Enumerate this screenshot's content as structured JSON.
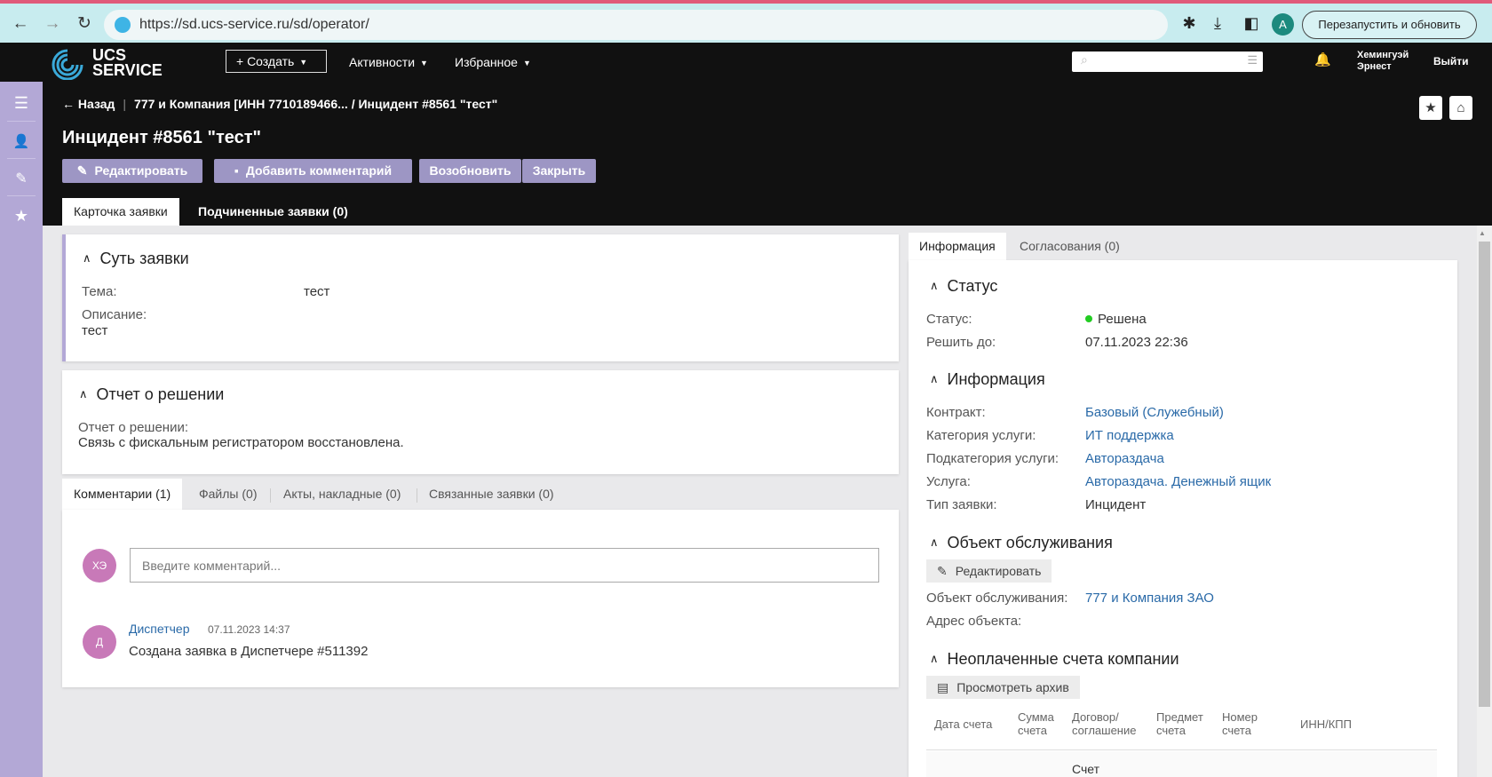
{
  "browser": {
    "url": "https://sd.ucs-service.ru/sd/operator/",
    "profile_initial": "A",
    "restart_label": "Перезапустить и обновить"
  },
  "topbar": {
    "logo_line1": "UCS",
    "logo_line2": "SERVICE",
    "create_label": "+ Создать",
    "activities_label": "Активности",
    "favorites_label": "Избранное",
    "user_first": "Хемингуэй",
    "user_last": "Эрнест",
    "logout_label": "Выйти"
  },
  "header": {
    "back_label": "← Назад",
    "crumb_company": "777 и Компания [ИНН 7710189466...",
    "crumb_incident": "/ Инцидент #8561 \"тест\"",
    "title": "Инцидент #8561 \"тест\"",
    "actions": {
      "edit": "Редактировать",
      "add_comment": "Добавить комментарий",
      "resume": "Возобновить",
      "close": "Закрыть"
    },
    "tabs": {
      "card": "Карточка заявки",
      "children": "Подчиненные заявки (0)"
    }
  },
  "essence": {
    "title": "Суть заявки",
    "subject_label": "Тема:",
    "subject_value": "тест",
    "description_label": "Описание:",
    "description_value": "тест"
  },
  "report": {
    "title": "Отчет о решении",
    "label": "Отчет о решении:",
    "value": "Связь с фискальным регистратором восстановлена."
  },
  "comment_tabs": {
    "comments": "Комментарии (1)",
    "files": "Файлы (0)",
    "acts": "Акты, накладные (0)",
    "linked": "Связанные заявки (0)"
  },
  "comments": {
    "my_initials": "ХЭ",
    "placeholder": "Введите комментарий...",
    "items": [
      {
        "initials": "Д",
        "author": "Диспетчер",
        "time": "07.11.2023 14:37",
        "text": "Создана заявка в Диспетчере #511392"
      }
    ]
  },
  "right_tabs": {
    "info": "Информация",
    "approvals": "Согласования (0)"
  },
  "status": {
    "title": "Статус",
    "status_label": "Статус:",
    "status_value": "Решена",
    "status_color": "#22cc22",
    "due_label": "Решить до:",
    "due_value": "07.11.2023 22:36"
  },
  "info": {
    "title": "Информация",
    "contract_label": "Контракт:",
    "contract_value": "Базовый (Служебный)",
    "category_label": "Категория услуги:",
    "category_value": "ИТ поддержка",
    "subcategory_label": "Подкатегория услуги:",
    "subcategory_value": "Авторaздача",
    "service_label": "Услуга:",
    "service_value": "Авторaздача. Денежный ящик",
    "type_label": "Тип заявки:",
    "type_value": "Инцидент"
  },
  "object": {
    "title": "Объект обслуживания",
    "edit_label": "Редактировать",
    "object_label": "Объект обслуживания:",
    "object_value": "777 и Компания ЗАО",
    "address_label": "Адрес объекта:"
  },
  "invoices": {
    "title": "Неоплаченные счета компании",
    "archive_label": "Просмотреть архив",
    "columns": {
      "date": "Дата счета",
      "sum1": "Сумма",
      "sum2": "счета",
      "contract1": "Договор/",
      "contract2": "соглашение",
      "subject1": "Предмет",
      "subject2": "счета",
      "number1": "Номер",
      "number2": "счета",
      "inn": "ИНН/КПП"
    },
    "row_partial": "Счет"
  }
}
